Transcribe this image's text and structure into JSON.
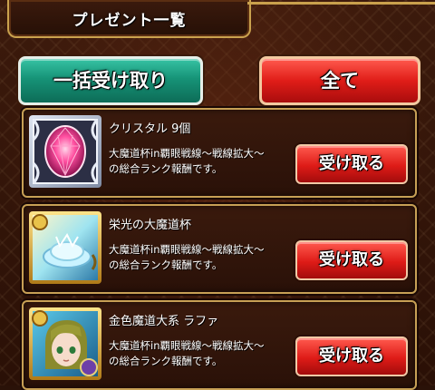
{
  "header": {
    "title": "プレゼント一覧"
  },
  "toolbar": {
    "receive_all_label": "一括受け取り",
    "filter_all_label": "全て"
  },
  "presents": [
    {
      "title": "クリスタル 9個",
      "desc_line1": "大魔道杯in覇眼戦線〜戦線拡大〜",
      "desc_line2": "の総合ランク報酬です。",
      "button": "受け取る",
      "icon": "crystal-icon"
    },
    {
      "title": "栄光の大魔道杯",
      "desc_line1": "大魔道杯in覇眼戦線〜戦線拡大〜",
      "desc_line2": "の総合ランク報酬です。",
      "button": "受け取る",
      "icon": "glory-cup-card-icon"
    },
    {
      "title": "金色魔道大系 ラファ",
      "desc_line1": "大魔道杯in覇眼戦線〜戦線拡大〜",
      "desc_line2": "の総合ランク報酬です。",
      "button": "受け取る",
      "icon": "rafa-character-card-icon"
    }
  ],
  "colors": {
    "accent_gold": "#c7a055",
    "green_button": "#169377",
    "red_button": "#e01d18",
    "background": "#2a1208"
  }
}
